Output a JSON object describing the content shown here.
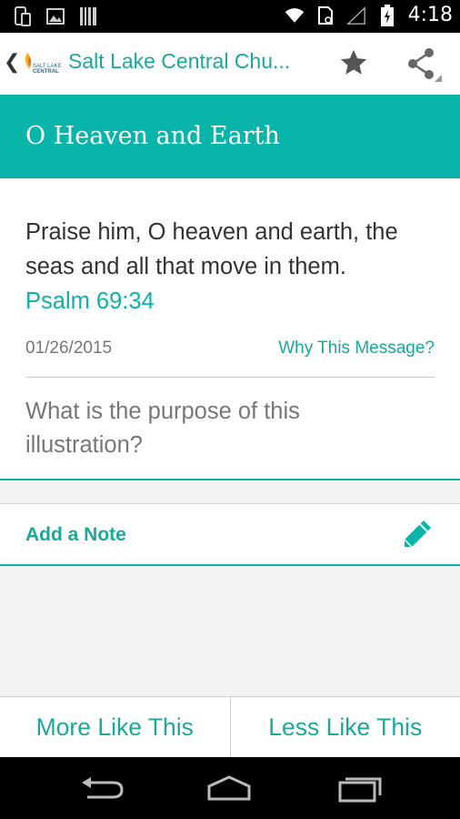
{
  "status_bar": {
    "time": "4:18",
    "icons": [
      "phone-tablet-icon",
      "image-icon",
      "barcode-icon",
      "wifi-icon",
      "sim-icon",
      "signal-icon",
      "battery-icon"
    ]
  },
  "app_bar": {
    "title": "Salt Lake Central Chu...",
    "logo_text": "SALT LAKE CENTRAL",
    "accent": "#1aa89c"
  },
  "banner": {
    "title": "O Heaven and Earth",
    "color": "#09b5a9"
  },
  "message": {
    "verse": "Praise him, O heaven and earth, the seas and all that move in them.",
    "reference": "Psalm 69:34",
    "date": "01/26/2015",
    "why_link": "Why This Message?",
    "question": "What is the purpose of this illustration?"
  },
  "note": {
    "label": "Add a Note"
  },
  "actions": {
    "more": "More Like This",
    "less": "Less Like This"
  }
}
